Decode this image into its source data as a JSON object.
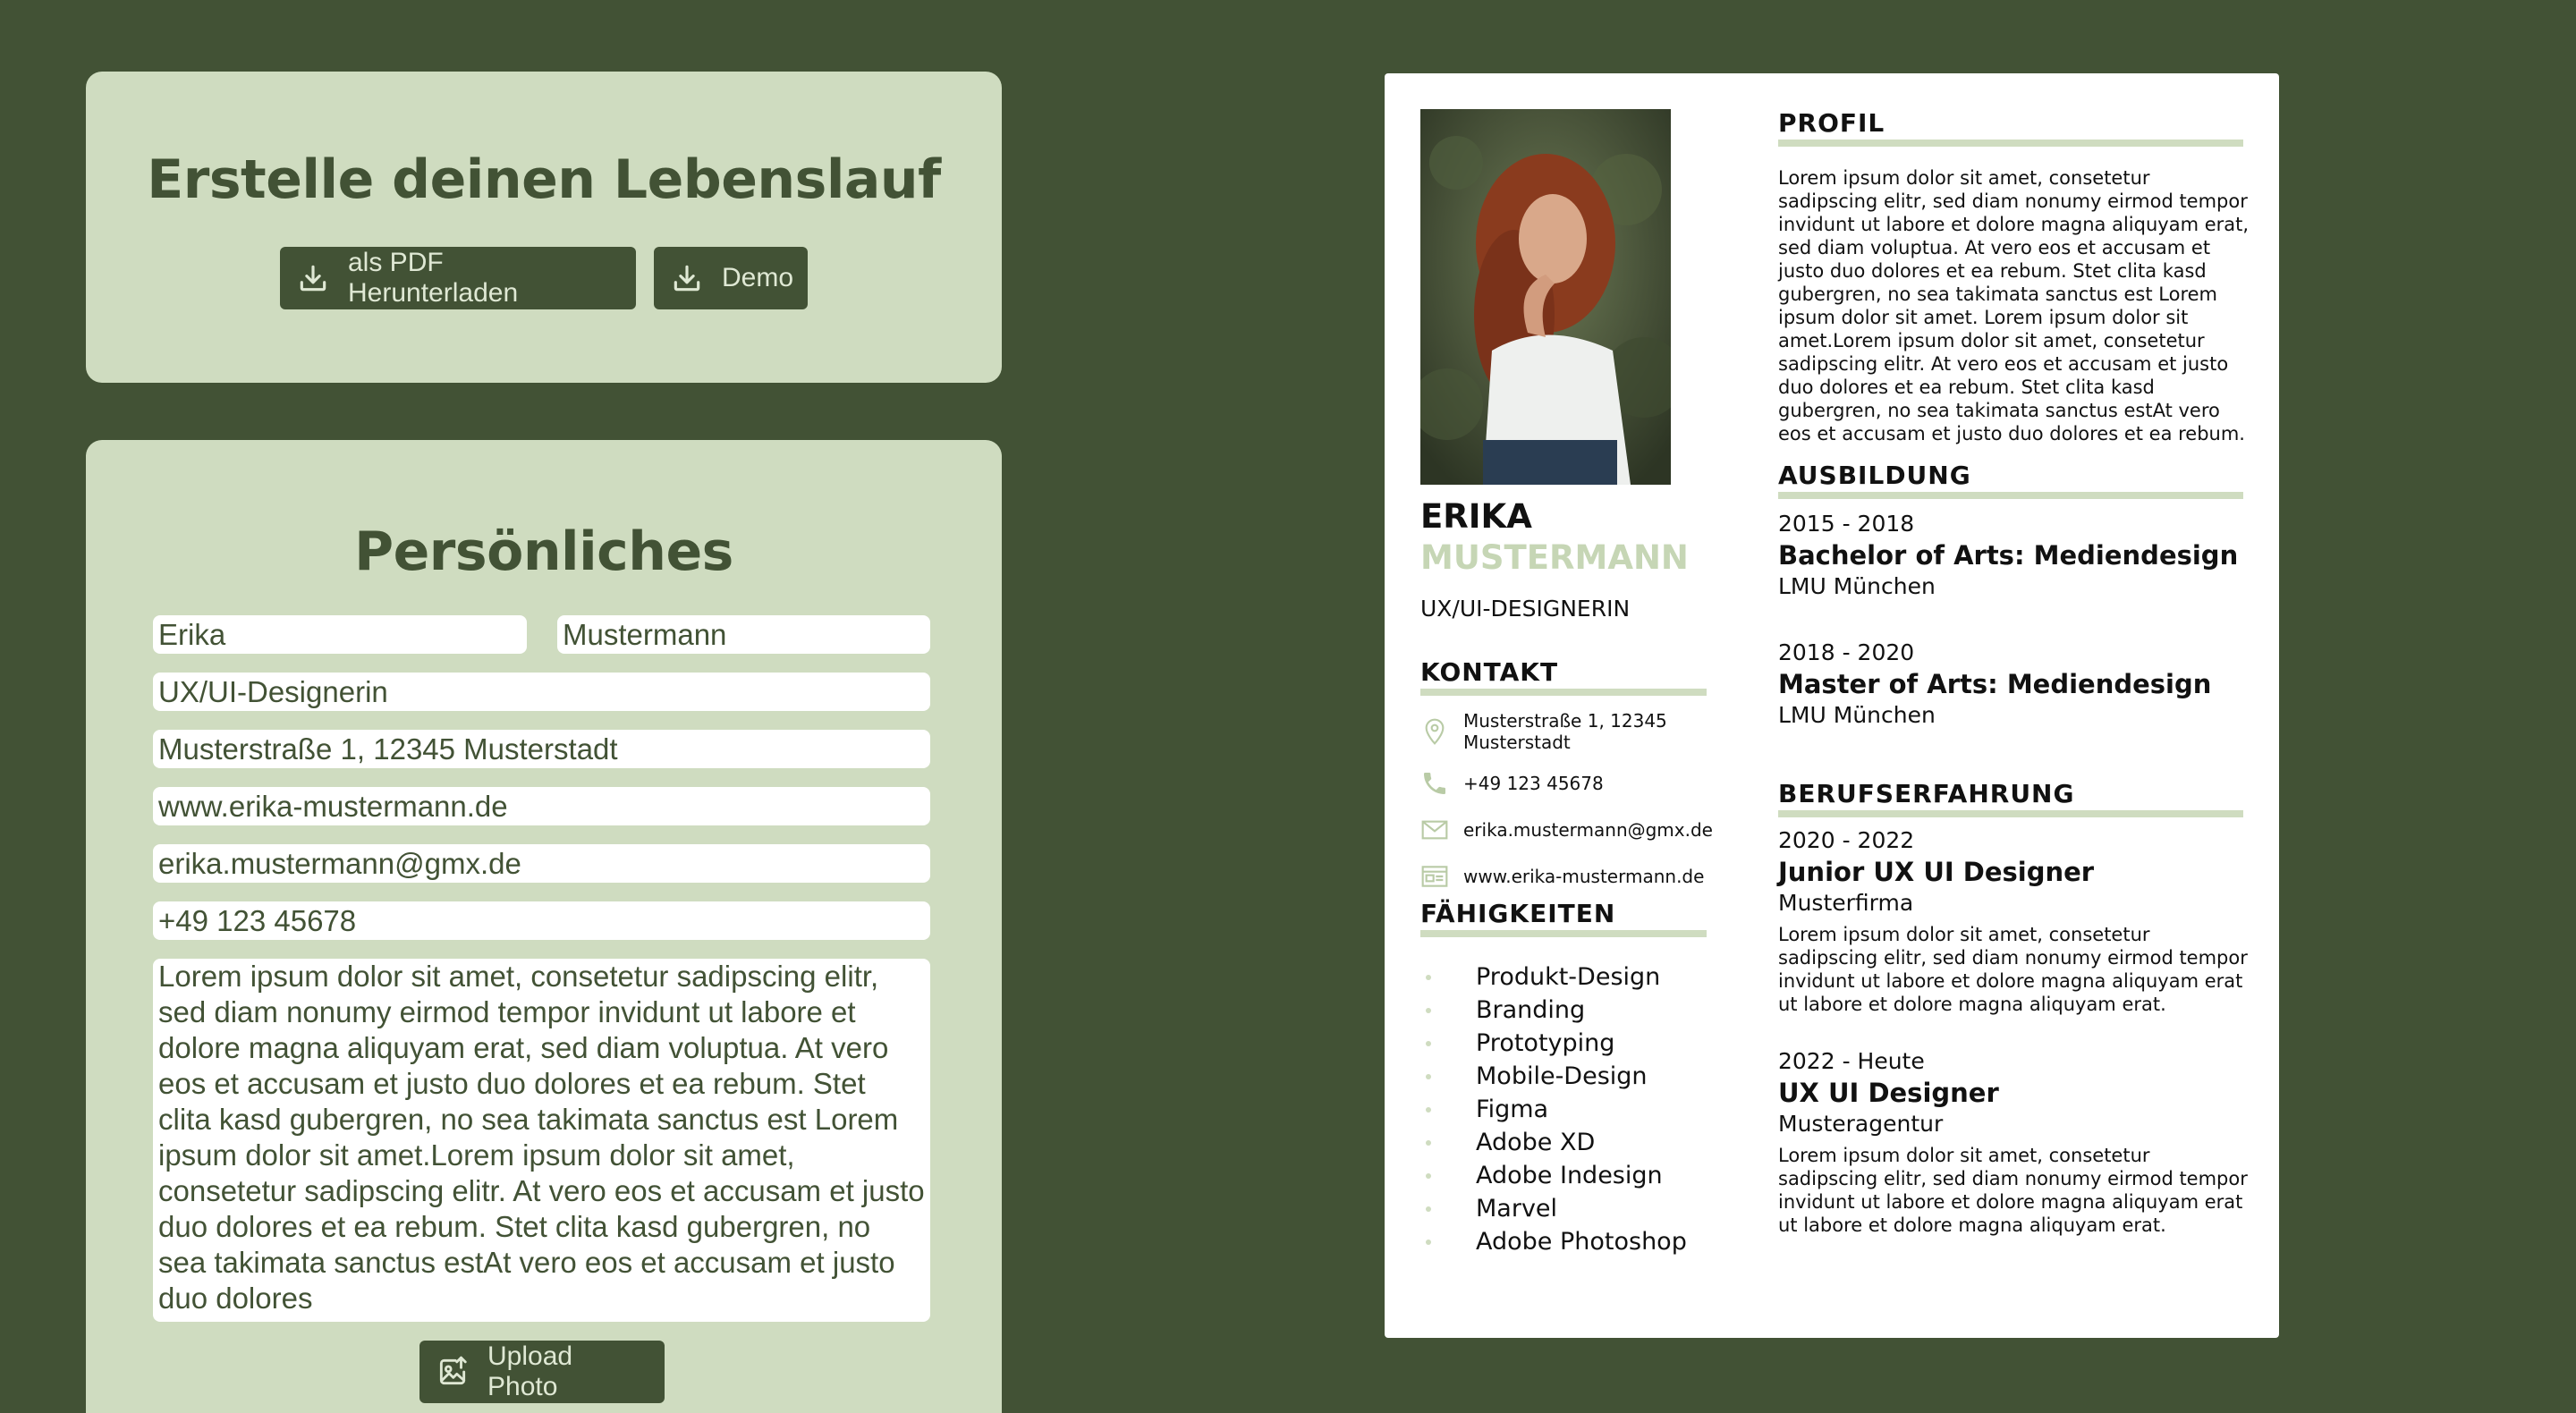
{
  "header_card": {
    "title": "Erstelle deinen Lebenslauf",
    "download_pdf_label": "als PDF Herunterladen",
    "demo_label": "Demo"
  },
  "form": {
    "title": "Persönliches",
    "first_name": "Erika",
    "last_name": "Mustermann",
    "job_title": "UX/UI-Designerin",
    "address": "Musterstraße 1, 12345 Musterstadt",
    "website": "www.erika-mustermann.de",
    "email": "erika.mustermann@gmx.de",
    "phone": "+49 123 45678",
    "bio": "Lorem ipsum dolor sit amet, consetetur sadipscing elitr, sed diam nonumy eirmod tempor invidunt ut labore et dolore magna aliquyam erat, sed diam voluptua. At vero eos et accusam et justo duo dolores et ea rebum. Stet clita kasd gubergren, no sea takimata sanctus est Lorem ipsum dolor sit amet.Lorem ipsum dolor sit amet, consetetur sadipscing elitr. At vero eos et accusam et justo duo dolores et ea rebum. Stet clita kasd gubergren, no sea takimata sanctus estAt vero eos et accusam et justo duo dolores",
    "upload_label": "Upload Photo"
  },
  "resume": {
    "first_name": "ERIKA",
    "last_name": "MUSTERMANN",
    "job_title": "UX/UI-DESIGNERIN",
    "contact_heading": "KONTAKT",
    "contact": {
      "address": "Musterstraße 1, 12345 Musterstadt",
      "phone": "+49 123 45678",
      "email": "erika.mustermann@gmx.de",
      "website": "www.erika-mustermann.de"
    },
    "skills_heading": "FÄHIGKEITEN",
    "skills": [
      "Produkt-Design",
      "Branding",
      "Prototyping",
      "Mobile-Design",
      "Figma",
      "Adobe XD",
      "Adobe Indesign",
      "Marvel",
      "Adobe Photoshop"
    ],
    "profile_heading": "PROFIL",
    "profile_text": "Lorem ipsum dolor sit amet, consetetur sadipscing elitr, sed diam nonumy eirmod tempor invidunt ut labore et dolore magna aliquyam erat, sed diam voluptua. At vero eos et accusam et justo duo dolores et ea rebum. Stet clita kasd gubergren, no sea takimata sanctus est Lorem ipsum dolor sit amet. Lorem ipsum dolor sit amet.Lorem ipsum dolor sit amet, consetetur sadipscing elitr. At vero eos et accusam et justo duo dolores et ea rebum. Stet clita kasd gubergren, no sea takimata sanctus estAt vero eos et accusam et justo duo dolores et ea rebum.",
    "education_heading": "AUSBILDUNG",
    "education": [
      {
        "period": "2015 - 2018",
        "degree": "Bachelor of Arts: Mediendesign",
        "school": "LMU München"
      },
      {
        "period": "2018 - 2020",
        "degree": "Master of Arts: Mediendesign",
        "school": "LMU München"
      }
    ],
    "work_heading": "BERUFSERFAHRUNG",
    "work": [
      {
        "period": "2020 - 2022",
        "role": "Junior UX UI Designer",
        "company": "Musterfirma",
        "description": "Lorem ipsum dolor sit amet, consetetur sadipscing elitr, sed diam nonumy eirmod tempor invidunt ut labore et dolore magna aliquyam erat ut labore et dolore magna aliquyam erat."
      },
      {
        "period": "2022 - Heute",
        "role": "UX UI Designer",
        "company": "Musteragentur",
        "description": "Lorem ipsum dolor sit amet, consetetur sadipscing elitr, sed diam nonumy eirmod tempor invidunt ut labore et dolore magna aliquyam erat ut labore et dolore magna aliquyam erat."
      }
    ]
  },
  "colors": {
    "background": "#425235",
    "panel": "#cfdcc0",
    "accent_dark": "#425235",
    "accent_light": "#c6d6b5"
  },
  "icons": {
    "download": "download-icon",
    "upload_photo": "image-upload-icon",
    "address": "location-pin-icon",
    "phone": "phone-icon",
    "email": "envelope-icon",
    "website": "browser-icon"
  }
}
